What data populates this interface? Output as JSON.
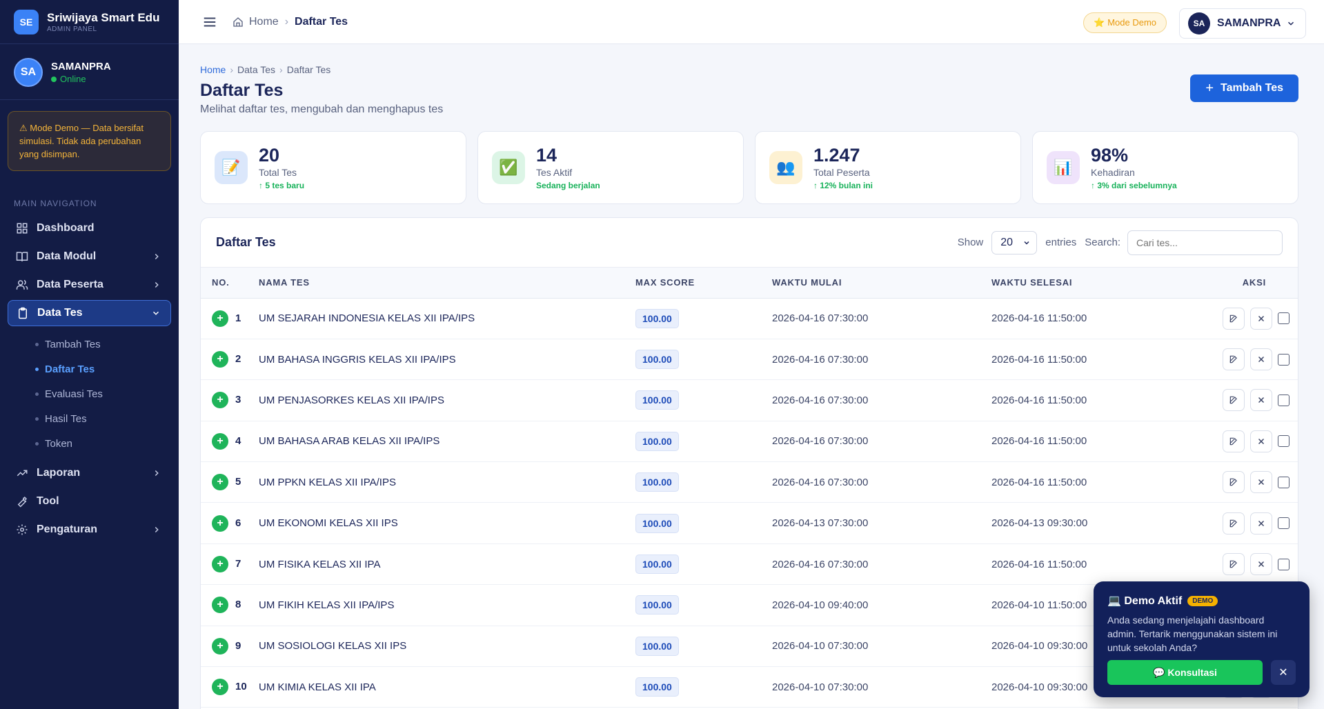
{
  "brand": {
    "logo": "SE",
    "name": "Sriwijaya Smart Edu",
    "subtitle": "ADMIN PANEL"
  },
  "user": {
    "initials": "SA",
    "name": "SAMANPRA",
    "status": "Online"
  },
  "demo_note": "⚠ Mode Demo — Data bersifat simulasi. Tidak ada perubahan yang disimpan.",
  "nav": {
    "heading": "MAIN NAVIGATION",
    "items": [
      {
        "label": "Dashboard",
        "icon": "grid-icon"
      },
      {
        "label": "Data Modul",
        "icon": "book-icon"
      },
      {
        "label": "Data Peserta",
        "icon": "users-icon"
      },
      {
        "label": "Data Tes",
        "icon": "clipboard-icon"
      },
      {
        "label": "Laporan",
        "icon": "trending-icon"
      },
      {
        "label": "Tool",
        "icon": "wrench-icon"
      },
      {
        "label": "Pengaturan",
        "icon": "gear-icon"
      }
    ],
    "sub_items": [
      "Tambah Tes",
      "Daftar Tes",
      "Evaluasi Tes",
      "Hasil Tes",
      "Token"
    ]
  },
  "topbar": {
    "crumb_home": "Home",
    "crumb_current": "Daftar Tes",
    "mode_label": "⭐ Mode Demo",
    "user_initials": "SA",
    "user_name": "SAMANPRA"
  },
  "page": {
    "breadcrumb": [
      "Home",
      "Data Tes",
      "Daftar Tes"
    ],
    "title": "Daftar Tes",
    "subtitle": "Melihat daftar tes, mengubah dan menghapus tes",
    "add_button": "Tambah Tes"
  },
  "stats": [
    {
      "value": "20",
      "label": "Total Tes",
      "trend": "↑ 5 tes baru",
      "icon": "📝",
      "color": "#dbe7fb"
    },
    {
      "value": "14",
      "label": "Tes Aktif",
      "trend": "Sedang berjalan",
      "icon": "✅",
      "color": "#dcf5e6"
    },
    {
      "value": "1.247",
      "label": "Total Peserta",
      "trend": "↑ 12% bulan ini",
      "icon": "👥",
      "color": "#fdf1d2"
    },
    {
      "value": "98%",
      "label": "Kehadiran",
      "trend": "↑ 3% dari sebelumnya",
      "icon": "📊",
      "color": "#efe3fb"
    }
  ],
  "table": {
    "title": "Daftar Tes",
    "show_label": "Show",
    "entries_value": "20",
    "entries_label": "entries",
    "search_label": "Search:",
    "search_placeholder": "Cari tes...",
    "columns": [
      "NO.",
      "NAMA TES",
      "MAX SCORE",
      "WAKTU MULAI",
      "WAKTU SELESAI",
      "AKSI"
    ],
    "rows": [
      {
        "no": "1",
        "name": "UM SEJARAH INDONESIA KELAS XII IPA/IPS",
        "score": "100.00",
        "start": "2026-04-16 07:30:00",
        "end": "2026-04-16 11:50:00"
      },
      {
        "no": "2",
        "name": "UM BAHASA INGGRIS KELAS XII IPA/IPS",
        "score": "100.00",
        "start": "2026-04-16 07:30:00",
        "end": "2026-04-16 11:50:00"
      },
      {
        "no": "3",
        "name": "UM PENJASORKES KELAS XII IPA/IPS",
        "score": "100.00",
        "start": "2026-04-16 07:30:00",
        "end": "2026-04-16 11:50:00"
      },
      {
        "no": "4",
        "name": "UM BAHASA ARAB KELAS XII IPA/IPS",
        "score": "100.00",
        "start": "2026-04-16 07:30:00",
        "end": "2026-04-16 11:50:00"
      },
      {
        "no": "5",
        "name": "UM PPKN KELAS XII IPA/IPS",
        "score": "100.00",
        "start": "2026-04-16 07:30:00",
        "end": "2026-04-16 11:50:00"
      },
      {
        "no": "6",
        "name": "UM EKONOMI KELAS XII IPS",
        "score": "100.00",
        "start": "2026-04-13 07:30:00",
        "end": "2026-04-13 09:30:00"
      },
      {
        "no": "7",
        "name": "UM FISIKA KELAS XII IPA",
        "score": "100.00",
        "start": "2026-04-16 07:30:00",
        "end": "2026-04-16 11:50:00"
      },
      {
        "no": "8",
        "name": "UM FIKIH KELAS XII IPA/IPS",
        "score": "100.00",
        "start": "2026-04-10 09:40:00",
        "end": "2026-04-10 11:50:00"
      },
      {
        "no": "9",
        "name": "UM SOSIOLOGI KELAS XII IPS",
        "score": "100.00",
        "start": "2026-04-10 07:30:00",
        "end": "2026-04-10 09:30:00"
      },
      {
        "no": "10",
        "name": "UM KIMIA KELAS XII IPA",
        "score": "100.00",
        "start": "2026-04-10 07:30:00",
        "end": "2026-04-10 09:30:00"
      }
    ]
  },
  "toast": {
    "title": "💻 Demo Aktif",
    "badge": "DEMO",
    "body": "Anda sedang menjelajahi dashboard admin. Tertarik menggunakan sistem ini untuk sekolah Anda?",
    "button": "💬 Konsultasi",
    "close": "✕"
  }
}
